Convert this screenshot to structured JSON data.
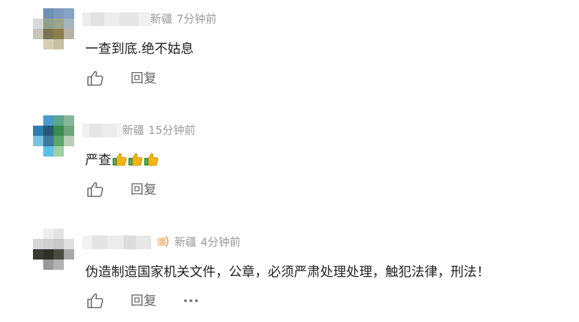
{
  "comments": [
    {
      "location": "新疆",
      "time": "7分钟前",
      "text": "一查到底.绝不姑息",
      "reply_label": "回复",
      "like_icon": "thumbs-up-outline-icon"
    },
    {
      "location": "新疆",
      "time": "15分钟前",
      "text": "严查",
      "emoji": [
        "thumbs-up-emoji",
        "thumbs-up-emoji",
        "thumbs-up-emoji"
      ],
      "reply_label": "回复",
      "like_icon": "thumbs-up-outline-icon"
    },
    {
      "location": "新疆",
      "time": "4分钟前",
      "text": "伪造制造国家机关文件，公章，必须严肃处理处理，触犯法律，刑法！",
      "reply_label": "回复",
      "like_icon": "thumbs-up-outline-icon",
      "more_icon": "more-dots-icon"
    }
  ],
  "colors": {
    "meta_text": "#9a9a9a",
    "body_text": "#222222",
    "action_text": "#666666",
    "background": "#ffffff"
  }
}
